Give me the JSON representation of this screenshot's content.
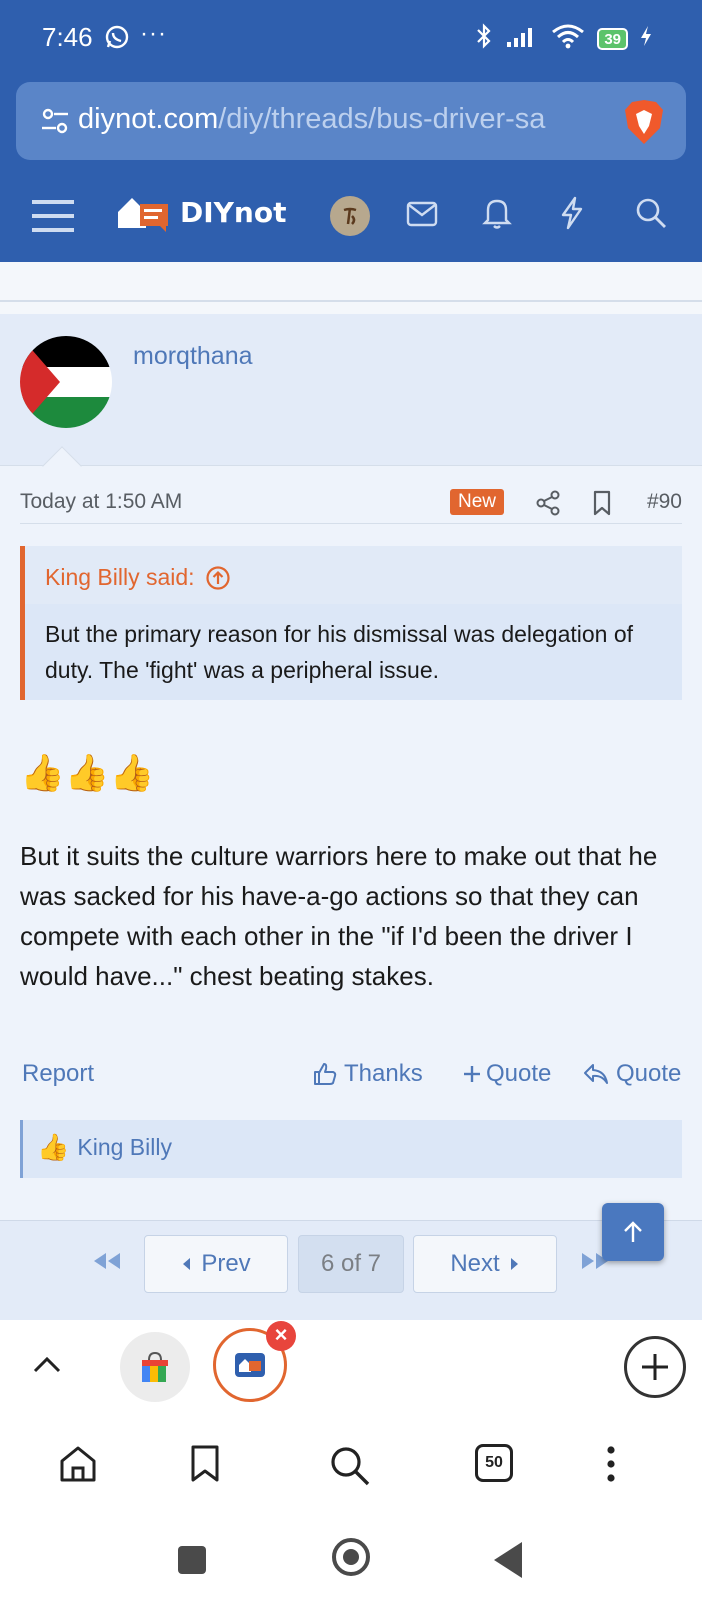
{
  "status": {
    "time": "7:46",
    "more": "···",
    "battery": "39"
  },
  "browser": {
    "url_host": "diynot.com",
    "url_path": "/diy/threads/bus-driver-sa",
    "tab_count": "50"
  },
  "site": {
    "logo_text": "DIYnot"
  },
  "post": {
    "username": "morqthana",
    "date": "Today at 1:50 AM",
    "badge": "New",
    "number": "#90",
    "quote_author": "King Billy said:",
    "quote_text": "But the primary reason for his dismissal was delegation of duty. The 'fight' was a peripheral issue.",
    "emoji": "👍👍👍",
    "body": "But it suits the culture warriors here to make out that he was sacked for his have-a-go actions so that they can compete with each other in the \"if I'd been the driver I would have...\" chest beating stakes.",
    "actions": {
      "report": "Report",
      "thanks": "Thanks",
      "plus_quote": "Quote",
      "reply_quote": "Quote"
    },
    "reaction_user": "King Billy"
  },
  "pagination": {
    "prev": "Prev",
    "current": "6 of 7",
    "next": "Next"
  },
  "colors": {
    "brand_blue": "#2f5fae",
    "accent_orange": "#e1662f",
    "link_blue": "#4f78b8"
  }
}
